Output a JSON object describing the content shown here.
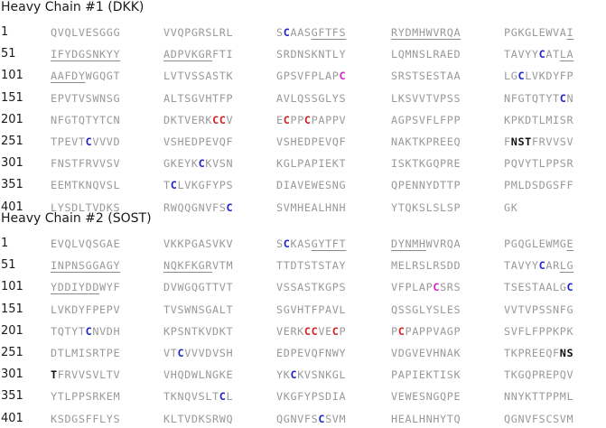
{
  "chains": [
    {
      "title": "Heavy Chain #1 (DKK)",
      "rows": [
        {
          "num": "1",
          "groups": [
            "QVQLVESGGG",
            "VVQPGRSLRL",
            "S[c:C]AAS[u:GFTFS]",
            "[u:RYDMHWVRQA]",
            "PGKGLEWVA[u:I]"
          ]
        },
        {
          "num": "51",
          "groups": [
            "[u:IFYDGSNKYY]",
            "[u:ADPVKGR]FTI",
            "SRDNSKNTLY",
            "LQMNSLRAED",
            "TAVYY[c:C]AT[u:LA]"
          ]
        },
        {
          "num": "101",
          "groups": [
            "[u:AAFDY]WGQGT",
            "LVTVSSASTK",
            "GPSVFPLAP[m:C]",
            "SRSTSESTAA",
            "LG[c:C]LVKDYFP"
          ]
        },
        {
          "num": "151",
          "groups": [
            "EPVTVSWNSG",
            "ALTSGVHTFP",
            "AVLQSSGLYS",
            "LKSVVTVPSS",
            "NFGTQTYT[c:C]N"
          ]
        },
        {
          "num": "201",
          "groups": [
            "NFGTQTYTCN",
            "DKTVERK[d:CC]V",
            "E[d:C]PP[d:C]PAPPV",
            "AGPSVFLFPP",
            "KPKDTLMISR"
          ]
        },
        {
          "num": "251",
          "groups": [
            "TPEVT[c:C]VVVD",
            "VSHEDPEVQF",
            "VSHEDPEVQF",
            "NAKTKPREEQ",
            "F[n:NST]FRVVSV"
          ]
        },
        {
          "num": "301",
          "groups": [
            "FNSTFRVVSV",
            "GKEYK[c:C]KVSN",
            "KGLPAPIEKT",
            "ISKTKGQPRE",
            "PQVYTLPPSR"
          ]
        },
        {
          "num": "351",
          "groups": [
            "EEMTKNQVSL",
            "T[c:C]LVKGFYPS",
            "DIAVEWESNG",
            "QPENNYDTTP",
            "PMLDSDGSFF"
          ]
        },
        {
          "num": "401",
          "groups": [
            "LYSDLTVDKS",
            "RWQQGNVFS[c:C]",
            "SVMHEALHNH",
            "YTQKSLSLSP",
            "GK"
          ]
        }
      ]
    },
    {
      "title": "Heavy Chain #2 (SOST)",
      "rows": [
        {
          "num": "1",
          "groups": [
            "EVQLVQSGAE",
            "VKKPGASVKV",
            "S[c:C]KAS[u:GYTFT]",
            "[u:DYNMH]WVRQA",
            "PGQGLEWMG[u:E]"
          ]
        },
        {
          "num": "51",
          "groups": [
            "[u:INPNSGGAGY]",
            "[u:NQKFKGR]VTM",
            "TTDTSTSTAY",
            "MELRSLRSDD",
            "TAVYY[c:C]AR[u:LG]"
          ]
        },
        {
          "num": "101",
          "groups": [
            "[u:YDDIYDD]WYF",
            "DVWGQGTTVT",
            "VSSASTKGPS",
            "VFPLAP[m:C]SRS",
            "TSESTAALG[c:C]"
          ]
        },
        {
          "num": "151",
          "groups": [
            "LVKDYFPEPV",
            "TVSWNSGALT",
            "SGVHTFPAVL",
            "QSSGLYSLES",
            "VVTVPSSNFG"
          ]
        },
        {
          "num": "201",
          "groups": [
            "TQTYT[c:C]NVDH",
            "KPSNTKVDKT",
            "VERK[d:CC]VE[d:C]P",
            "P[d:C]PAPPVAGP",
            "SVFLFPPKPK"
          ]
        },
        {
          "num": "251",
          "groups": [
            "DTLMISRTPE",
            "VT[c:C]VVVDVSH",
            "EDPEVQFNWY",
            "VDGVEVHNAK",
            "TKPREEQF[n:NS]"
          ]
        },
        {
          "num": "301",
          "groups": [
            "[n:T]FRVVSVLTV",
            "VHQDWLNGKE",
            "YK[c:C]KVSNKGL",
            "PAPIEKTISK",
            "TKGQPREPQV"
          ]
        },
        {
          "num": "351",
          "groups": [
            "YTLPPSRKEM",
            "TKNQVSLT[c:C]L",
            "VKGFYPSDIA",
            "VEWESNGQPE",
            "NNYKTTPPML"
          ]
        },
        {
          "num": "401",
          "groups": [
            "KSDGSFFLYS",
            "KLTVDKSRWQ",
            "QGNVFS[c:C]SVM",
            "HEALHNHYTQ",
            "QGNVFSCSVM"
          ]
        }
      ]
    }
  ]
}
